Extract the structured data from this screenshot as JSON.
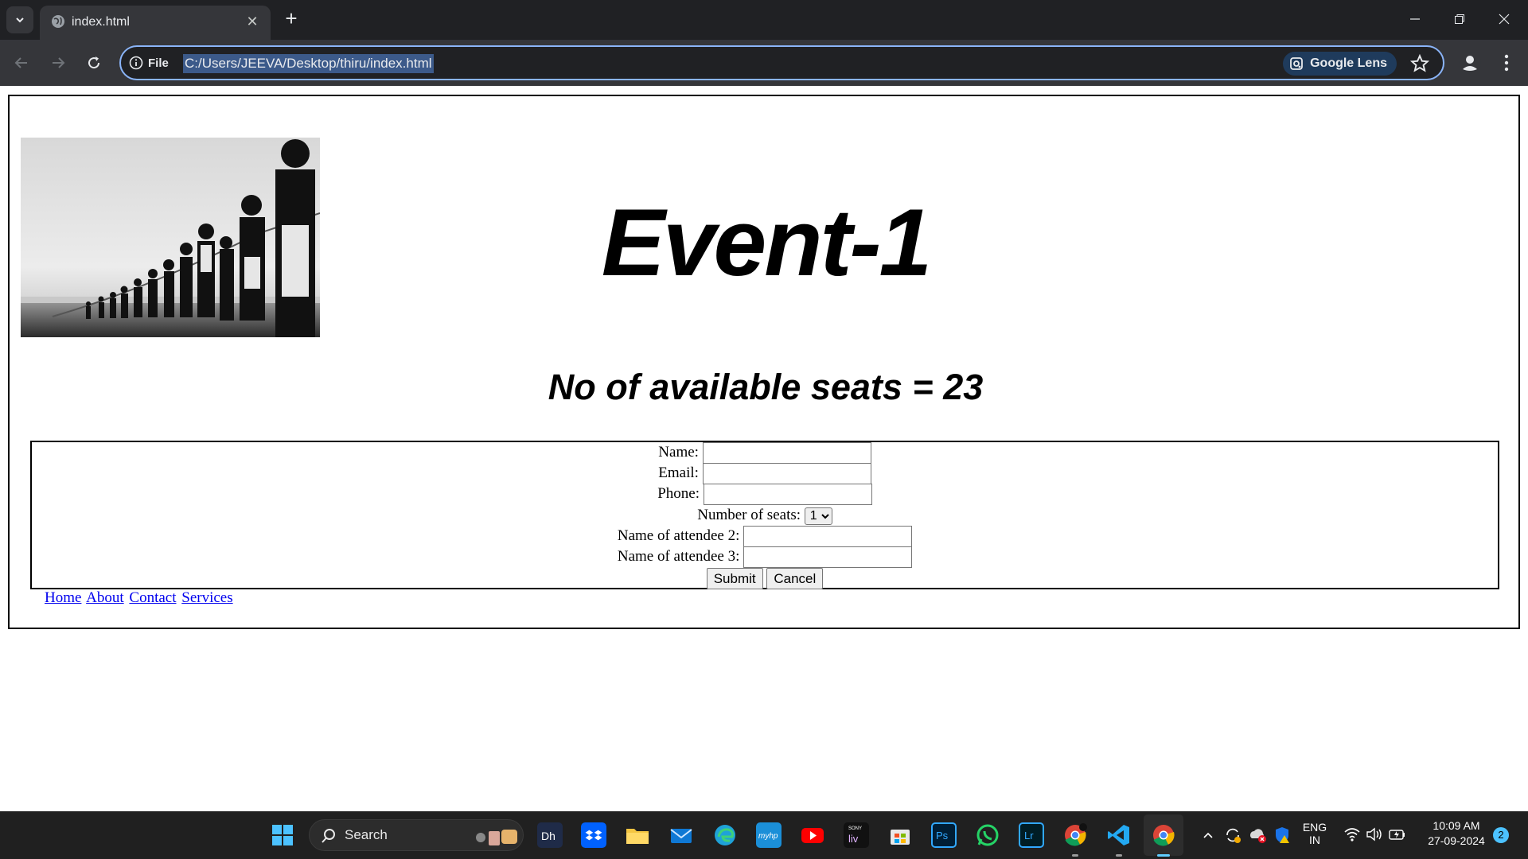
{
  "browser": {
    "tab_title": "index.html",
    "site_chip": "File",
    "url": "C:/Users/JEEVA/Desktop/thiru/index.html",
    "lens_label": "Google Lens"
  },
  "page": {
    "event_title": "Event-1",
    "seats_text": "No of available seats = 23",
    "form": {
      "name_label": "Name:",
      "email_label": "Email:",
      "phone_label": "Phone:",
      "seats_label": "Number of seats:",
      "seats_value": "1",
      "attendee2_label": "Name of attendee 2:",
      "attendee3_label": "Name of attendee 3:",
      "submit_label": "Submit",
      "cancel_label": "Cancel"
    },
    "nav": {
      "home": "Home",
      "about": "About",
      "contact": "Contact",
      "services": "Services"
    }
  },
  "taskbar": {
    "search_label": "Search",
    "lang_top": "ENG",
    "lang_bottom": "IN",
    "time": "10:09 AM",
    "date": "27-09-2024",
    "notification_count": "2"
  },
  "colors": {
    "link": "#0000ee",
    "omnibox_border": "#8ab4f8",
    "chrome_dark": "#202124",
    "chrome_toolbar": "#35363a"
  }
}
